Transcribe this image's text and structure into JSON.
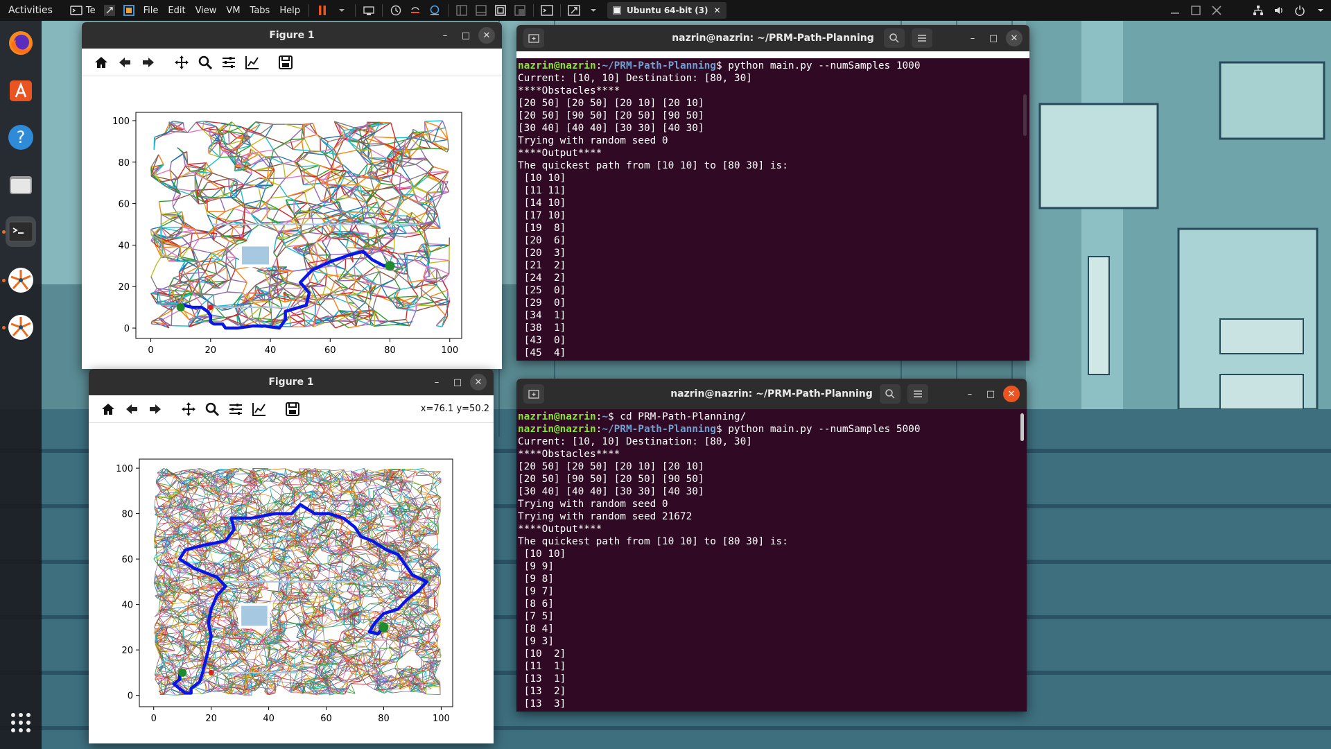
{
  "host_bar": {
    "activities": "Activities",
    "app_short": "Te",
    "menus": [
      "File",
      "Edit",
      "View",
      "VM",
      "Tabs",
      "Help"
    ],
    "vm_tab": "Ubuntu 64-bit (3)"
  },
  "dock": {
    "items": [
      {
        "name": "firefox-icon"
      },
      {
        "name": "software-center-icon"
      },
      {
        "name": "help-icon"
      },
      {
        "name": "files-icon"
      },
      {
        "name": "terminal-icon"
      },
      {
        "name": "python-figure-icon"
      },
      {
        "name": "python-figure-icon-2"
      }
    ],
    "apps_grid": "show-applications-icon"
  },
  "figure_top": {
    "title": "Figure 1",
    "chart_data": {
      "type": "scatter",
      "title": "",
      "xlabel": "",
      "ylabel": "",
      "xlim": [
        -5,
        104
      ],
      "ylim": [
        -5,
        104
      ],
      "xticks": [
        "0",
        "20",
        "40",
        "60",
        "80",
        "100"
      ],
      "yticks": [
        "0",
        "20",
        "40",
        "60",
        "80",
        "100"
      ],
      "num_samples": 1000,
      "start": [
        10,
        10
      ],
      "destination": [
        80,
        30
      ],
      "obstacles": [
        {
          "x": [
            20,
            50
          ],
          "y": [
            10,
            10
          ]
        },
        {
          "x": [
            20,
            90
          ],
          "y": [
            50,
            50
          ]
        },
        {
          "x": [
            30,
            40
          ],
          "y": [
            30,
            40
          ]
        }
      ],
      "path": [
        [
          10,
          10
        ],
        [
          11,
          11
        ],
        [
          14,
          10
        ],
        [
          17,
          10
        ],
        [
          19,
          8
        ],
        [
          20,
          6
        ],
        [
          20,
          3
        ],
        [
          21,
          2
        ],
        [
          24,
          2
        ],
        [
          25,
          0
        ],
        [
          29,
          0
        ],
        [
          34,
          1
        ],
        [
          38,
          1
        ],
        [
          43,
          0
        ],
        [
          45,
          4
        ],
        [
          45,
          8
        ],
        [
          52,
          11
        ],
        [
          53,
          17
        ],
        [
          50,
          22
        ],
        [
          54,
          28
        ],
        [
          60,
          32
        ],
        [
          66,
          35
        ],
        [
          71,
          37
        ],
        [
          74,
          33
        ],
        [
          78,
          30
        ],
        [
          80,
          30
        ]
      ]
    }
  },
  "figure_bottom": {
    "title": "Figure 1",
    "coords": "x=76.1 y=50.2",
    "chart_data": {
      "type": "scatter",
      "title": "",
      "xlabel": "",
      "ylabel": "",
      "xlim": [
        -5,
        104
      ],
      "ylim": [
        -5,
        104
      ],
      "xticks": [
        "0",
        "20",
        "40",
        "60",
        "80",
        "100"
      ],
      "yticks": [
        "0",
        "20",
        "40",
        "60",
        "80",
        "100"
      ],
      "num_samples": 5000,
      "start": [
        10,
        10
      ],
      "destination": [
        80,
        30
      ],
      "obstacles": [
        {
          "x": [
            20,
            50
          ],
          "y": [
            10,
            10
          ]
        },
        {
          "x": [
            20,
            90
          ],
          "y": [
            50,
            50
          ]
        },
        {
          "x": [
            30,
            40
          ],
          "y": [
            30,
            40
          ]
        }
      ],
      "path": [
        [
          10,
          10
        ],
        [
          9,
          9
        ],
        [
          9,
          8
        ],
        [
          9,
          7
        ],
        [
          8,
          6
        ],
        [
          7,
          5
        ],
        [
          8,
          4
        ],
        [
          9,
          3
        ],
        [
          10,
          2
        ],
        [
          11,
          1
        ],
        [
          13,
          1
        ],
        [
          13,
          2
        ],
        [
          13,
          3
        ],
        [
          16,
          6
        ],
        [
          17,
          10
        ],
        [
          18,
          15
        ],
        [
          19,
          20
        ],
        [
          20,
          26
        ],
        [
          19,
          32
        ],
        [
          20,
          38
        ],
        [
          22,
          44
        ],
        [
          25,
          48
        ],
        [
          22,
          52
        ],
        [
          14,
          56
        ],
        [
          9,
          60
        ],
        [
          11,
          64
        ],
        [
          17,
          66
        ],
        [
          25,
          68
        ],
        [
          28,
          73
        ],
        [
          27,
          78
        ],
        [
          34,
          78
        ],
        [
          42,
          80
        ],
        [
          48,
          80
        ],
        [
          51,
          84
        ],
        [
          56,
          80
        ],
        [
          61,
          80
        ],
        [
          66,
          78
        ],
        [
          70,
          74
        ],
        [
          72,
          70
        ],
        [
          76,
          68
        ],
        [
          81,
          64
        ],
        [
          85,
          62
        ],
        [
          90,
          53
        ],
        [
          95,
          50
        ],
        [
          92,
          46
        ],
        [
          88,
          42
        ],
        [
          85,
          38
        ],
        [
          80,
          36
        ],
        [
          77,
          32
        ],
        [
          75,
          28
        ],
        [
          78,
          27
        ],
        [
          80,
          30
        ]
      ]
    }
  },
  "terminal_top": {
    "title": "nazrin@nazrin: ~/PRM-Path-Planning",
    "lines": [
      {
        "user": "nazrin@nazrin",
        "path": "~/PRM-Path-Planning",
        "cmd": "$ python main.py --numSamples 1000"
      },
      {
        "text": "Current: [10, 10] Destination: [80, 30]"
      },
      {
        "text": "****Obstacles****"
      },
      {
        "text": "[20 50] [20 50] [20 10] [20 10]"
      },
      {
        "text": "[20 50] [90 50] [20 50] [90 50]"
      },
      {
        "text": "[30 40] [40 40] [30 30] [40 30]"
      },
      {
        "text": "Trying with random seed 0"
      },
      {
        "text": "****Output****"
      },
      {
        "text": "The quickest path from [10 10] to [80 30] is:"
      },
      {
        "text": " [10 10]"
      },
      {
        "text": " [11 11]"
      },
      {
        "text": " [14 10]"
      },
      {
        "text": " [17 10]"
      },
      {
        "text": " [19  8]"
      },
      {
        "text": " [20  6]"
      },
      {
        "text": " [20  3]"
      },
      {
        "text": " [21  2]"
      },
      {
        "text": " [24  2]"
      },
      {
        "text": " [25  0]"
      },
      {
        "text": " [29  0]"
      },
      {
        "text": " [34  1]"
      },
      {
        "text": " [38  1]"
      },
      {
        "text": " [43  0]"
      },
      {
        "text": " [45  4]"
      }
    ]
  },
  "terminal_bottom": {
    "title": "nazrin@nazrin: ~/PRM-Path-Planning",
    "lines": [
      {
        "user": "nazrin@nazrin",
        "path": "~",
        "cmd": "$ cd PRM-Path-Planning/"
      },
      {
        "user": "nazrin@nazrin",
        "path": "~/PRM-Path-Planning",
        "cmd": "$ python main.py --numSamples 5000"
      },
      {
        "text": "Current: [10, 10] Destination: [80, 30]"
      },
      {
        "text": "****Obstacles****"
      },
      {
        "text": "[20 50] [20 50] [20 10] [20 10]"
      },
      {
        "text": "[20 50] [90 50] [20 50] [90 50]"
      },
      {
        "text": "[30 40] [40 40] [30 30] [40 30]"
      },
      {
        "text": "Trying with random seed 0"
      },
      {
        "text": "Trying with random seed 21672"
      },
      {
        "text": "****Output****"
      },
      {
        "text": "The quickest path from [10 10] to [80 30] is:"
      },
      {
        "text": " [10 10]"
      },
      {
        "text": " [9 9]"
      },
      {
        "text": " [9 8]"
      },
      {
        "text": " [9 7]"
      },
      {
        "text": " [8 6]"
      },
      {
        "text": " [7 5]"
      },
      {
        "text": " [8 4]"
      },
      {
        "text": " [9 3]"
      },
      {
        "text": " [10  2]"
      },
      {
        "text": " [11  1]"
      },
      {
        "text": " [13  1]"
      },
      {
        "text": " [13  2]"
      },
      {
        "text": " [13  3]"
      }
    ]
  },
  "colors": {
    "terminal_bg": "#300a24",
    "prompt_user": "#8ae234",
    "prompt_path": "#729fcf",
    "path_line": "#0a16e6",
    "obstacle_fill": "#a6c8e0",
    "start_marker": "#1f8a2e",
    "goal_marker": "#d62728",
    "ubuntu_orange": "#e95420"
  }
}
